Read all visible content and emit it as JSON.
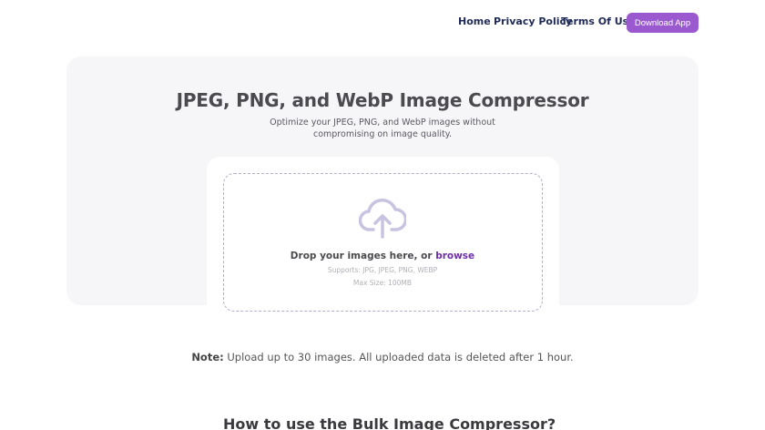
{
  "nav": {
    "links": [
      "Home",
      "Privacy Policy",
      "Terms Of Use"
    ],
    "download_label": "Download App"
  },
  "hero": {
    "title": "JPEG, PNG, and WebP Image Compressor",
    "subtitle": "Optimize your JPEG, PNG, and WebP images without compromising on image quality."
  },
  "upload": {
    "icon": "cloud-upload-icon",
    "drop_prefix": "Drop your images here, or ",
    "browse_label": "browse",
    "supports": "Supports: JPG, JPEG, PNG, WEBP",
    "max_size": "Max Size: 100MB"
  },
  "note": {
    "label": "Note:",
    "text": " Upload up to 30 images. All uploaded data is deleted after 1 hour."
  },
  "section": {
    "heading": "How to use the Bulk Image Compressor?"
  },
  "colors": {
    "accent": "#9b59d0",
    "browse": "#6c2fa8",
    "nav_text": "#1f2a56",
    "hero_bg": "#f6f6f8",
    "dashed_border": "#b3aecb"
  }
}
